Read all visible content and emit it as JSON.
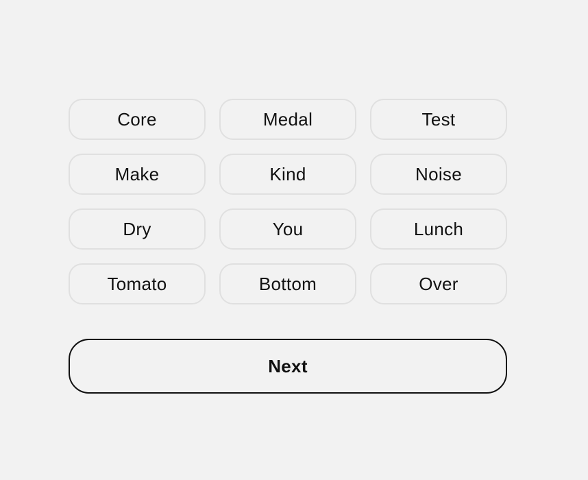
{
  "words": [
    "Core",
    "Medal",
    "Test",
    "Make",
    "Kind",
    "Noise",
    "Dry",
    "You",
    "Lunch",
    "Tomato",
    "Bottom",
    "Over"
  ],
  "next_button": {
    "label": "Next"
  },
  "colors": {
    "background": "#f2f2f2",
    "chip_border": "#e0e0e0",
    "button_border": "#111111",
    "text": "#111111"
  }
}
